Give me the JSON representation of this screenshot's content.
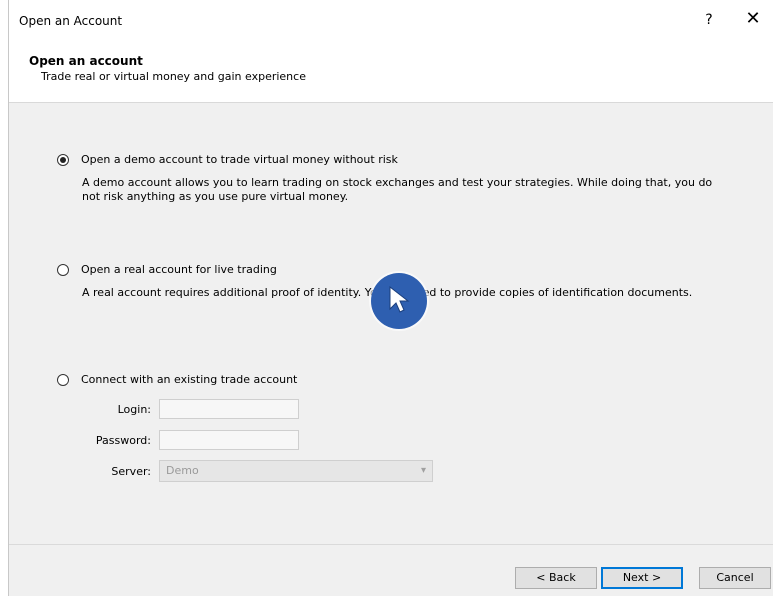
{
  "window": {
    "title": "Open an Account",
    "help": "?",
    "close": "✕"
  },
  "header": {
    "title": "Open an account",
    "subtitle": "Trade real or virtual money and gain experience"
  },
  "options": [
    {
      "label": "Open a demo account to trade virtual money without risk",
      "description": "A demo account allows you to learn trading on stock exchanges and test your strategies. While doing that, you do not risk anything as you use pure virtual money.",
      "checked": true
    },
    {
      "label": "Open a real account for live trading",
      "description": "A real account requires additional proof of identity. You will need to provide copies of identification documents.",
      "checked": false
    },
    {
      "label": "Connect with an existing trade account",
      "checked": false
    }
  ],
  "form": {
    "login_label": "Login:",
    "password_label": "Password:",
    "server_label": "Server:",
    "server_value": "Demo"
  },
  "buttons": {
    "back": "< Back",
    "next": "Next >",
    "cancel": "Cancel"
  },
  "colors": {
    "content_bg": "#f0f0f0",
    "accent": "#0078d7",
    "cursor_badge": "#2e5fb0"
  }
}
